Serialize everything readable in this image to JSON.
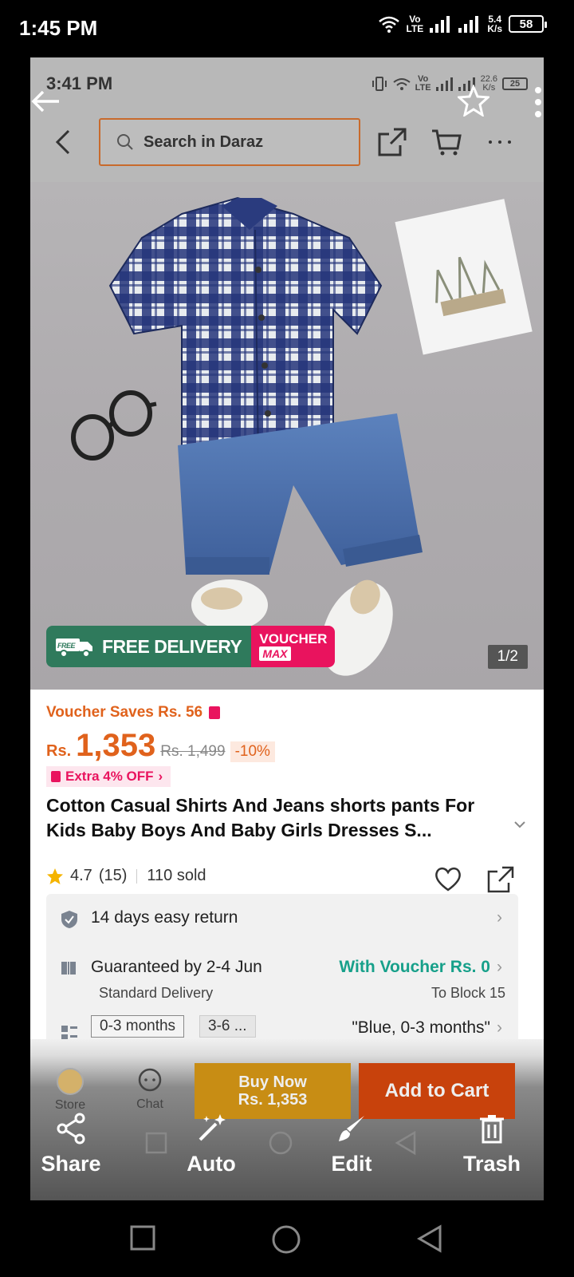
{
  "outer_status": {
    "time": "1:45 PM",
    "net_top": "Vo",
    "net_bottom": "LTE",
    "speed_top": "5.4",
    "speed_bottom": "K/s",
    "battery": "58"
  },
  "inner_status": {
    "time": "3:41 PM",
    "net_top": "Vo",
    "net_bottom": "LTE",
    "speed_top": "22.6",
    "speed_bottom": "K/s",
    "battery": "25"
  },
  "search": {
    "placeholder": "Search in Daraz"
  },
  "badges": {
    "free_tag": "FREE",
    "free_delivery": "FREE DELIVERY",
    "voucher": "VOUCHER",
    "max": "MAX"
  },
  "gallery": {
    "page_indicator": "1/2"
  },
  "product": {
    "voucher_saves": "Voucher Saves Rs. 56",
    "currency": "Rs.",
    "price": "1,353",
    "old_price": "Rs. 1,499",
    "discount": "-10%",
    "extra_off": "Extra 4% OFF",
    "title": "Cotton Casual Shirts And Jeans shorts pants For Kids Baby Boys And Baby Girls Dresses S...",
    "rating": "4.7",
    "reviews": "(15)",
    "sold": "110 sold"
  },
  "info": {
    "return_text": "14 days easy return",
    "delivery_text": "Guaranteed by 2-4 Jun",
    "delivery_voucher": "With Voucher Rs. 0",
    "delivery_type": "Standard Delivery",
    "delivery_to": "To Block 15",
    "variant_1": "0-3 months",
    "variant_2": "3-6 ...",
    "selected_variant": "\"Blue, 0-3 months\""
  },
  "purchase_bar": {
    "store": "Store",
    "chat": "Chat",
    "buy_now_line1": "Buy Now",
    "buy_now_line2": "Rs. 1,353",
    "add_to_cart": "Add to Cart"
  },
  "toolbar": {
    "share": "Share",
    "auto": "Auto",
    "edit": "Edit",
    "trash": "Trash"
  },
  "colors": {
    "accent_orange": "#e0621c",
    "voucher_pink": "#e9135e",
    "delivery_green": "#2f7a5c",
    "teal": "#17a08a"
  }
}
